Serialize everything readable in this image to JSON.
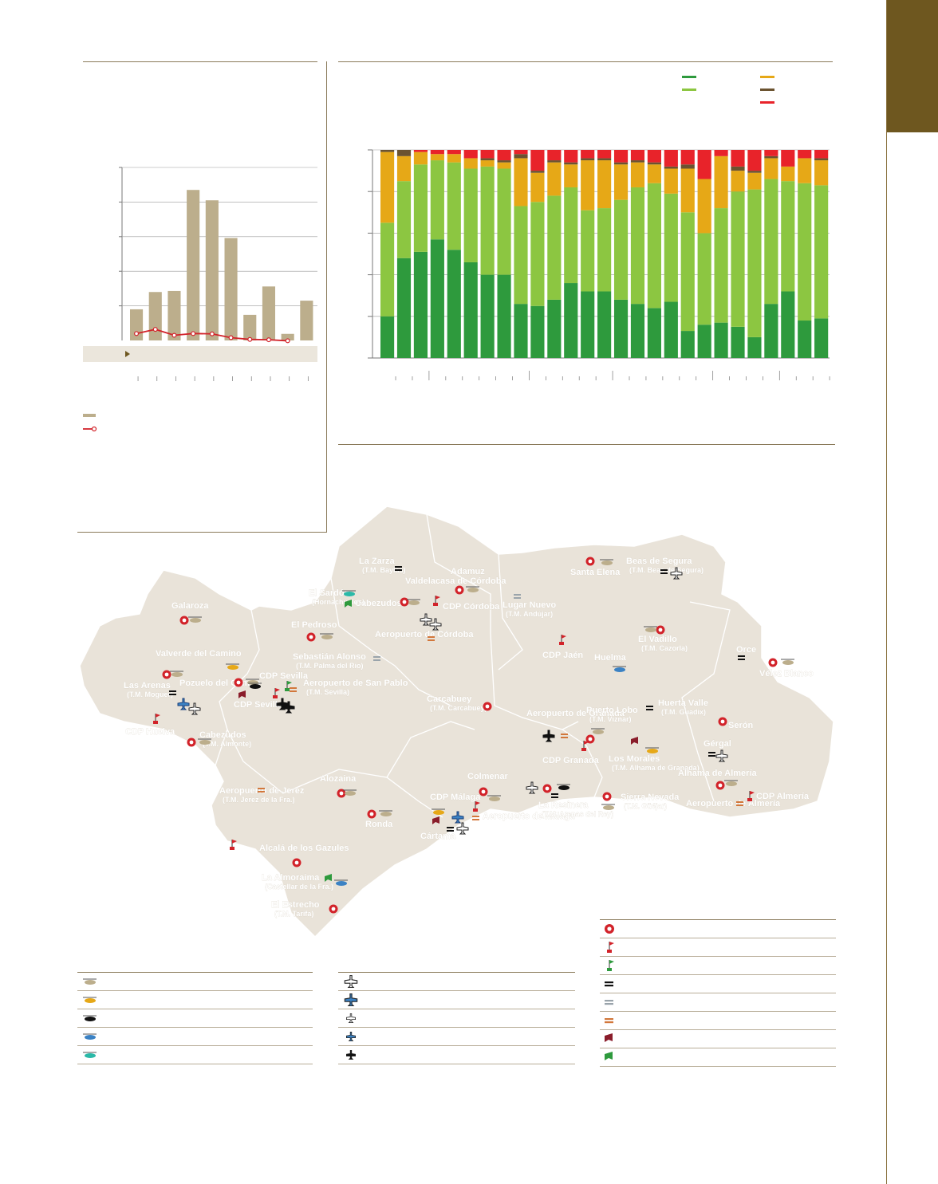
{
  "colors": {
    "brand": "#6e571f",
    "bar_tan": "#bcae8c",
    "line_red": "#d2232a",
    "dark_green": "#2e9a3d",
    "light_green": "#8cc641",
    "orange": "#e6a817",
    "brown": "#6b5330",
    "red": "#e8232a",
    "map_fill": "#e9e3d9",
    "map_stroke": "#ffffff",
    "label_white": "#ffffff"
  },
  "left_chart": {
    "chart_data": {
      "type": "bar",
      "values": [
        9,
        14,
        14.3,
        43.5,
        40.5,
        29.6,
        7.4,
        15.6,
        1.9,
        11.5
      ],
      "line_values": [
        2,
        3.2,
        1.5,
        2,
        1.9,
        0.8,
        0.3,
        0.2,
        -0.1
      ],
      "ylim": [
        0,
        50
      ],
      "grid": true,
      "title": "",
      "xlabel": "",
      "ylabel": ""
    },
    "legend_items": [
      {
        "name": "",
        "icon": "tan-bar-swatch"
      },
      {
        "name": "",
        "icon": "red-line-marker"
      }
    ],
    "strip_marker": "triangle-right-icon"
  },
  "right_chart": {
    "chart_data": {
      "type": "bar",
      "stacked": true,
      "ylim": [
        0,
        100
      ],
      "grid": true,
      "series": [
        {
          "color_key": "dark_green",
          "values": [
            20,
            48,
            51,
            57,
            52,
            46,
            40,
            40,
            26,
            25,
            28,
            36,
            32,
            32,
            28,
            26,
            24,
            27,
            13,
            16,
            17,
            15,
            10,
            26,
            32,
            18,
            19
          ]
        },
        {
          "color_key": "light_green",
          "values": [
            45,
            37,
            42,
            38,
            42,
            45,
            52,
            51,
            47,
            50,
            50,
            46,
            39,
            40,
            48,
            56,
            60,
            52,
            57,
            44,
            55,
            65,
            71,
            60,
            53,
            66,
            64
          ]
        },
        {
          "color_key": "orange",
          "values": [
            34,
            12,
            6,
            3,
            4,
            5,
            3,
            3,
            23,
            14,
            16,
            11,
            24,
            23,
            17,
            12,
            9,
            12,
            21,
            26,
            25,
            10,
            8,
            10,
            7,
            12,
            12
          ]
        },
        {
          "color_key": "brown",
          "values": [
            1,
            3,
            0,
            0,
            0,
            0,
            1,
            1,
            2,
            1,
            1,
            1,
            1,
            1,
            1,
            1,
            1,
            1,
            2,
            0,
            0,
            2,
            1,
            1,
            0,
            0,
            1
          ]
        },
        {
          "color_key": "red",
          "values": [
            0,
            0,
            1,
            2,
            2,
            4,
            4,
            5,
            2,
            10,
            5,
            6,
            4,
            4,
            6,
            5,
            6,
            8,
            7,
            14,
            3,
            8,
            10,
            3,
            8,
            4,
            4
          ]
        }
      ],
      "title": "",
      "xlabel": "",
      "ylabel": ""
    },
    "legend_items": [
      {
        "color_key": "dark_green",
        "name": ""
      },
      {
        "color_key": "light_green",
        "name": ""
      },
      {
        "color_key": "orange",
        "name": ""
      },
      {
        "color_key": "brown",
        "name": ""
      },
      {
        "color_key": "red",
        "name": ""
      }
    ]
  },
  "map": {
    "places": [
      {
        "name": "La Zarza",
        "sub": "(T.M. Baylas)"
      },
      {
        "name": "Valdelacasa de Córdoba"
      },
      {
        "name": "Adamuz"
      },
      {
        "name": "Santa Elena"
      },
      {
        "name": "Beas de Segura",
        "sub": "(T.M. Beas de Segura)"
      },
      {
        "name": "Cabezudos"
      },
      {
        "name": "Galaroza"
      },
      {
        "name": "El Pedroso"
      },
      {
        "name": "Aeropuerto de Córdoba"
      },
      {
        "name": "CDP Córdoba"
      },
      {
        "name": "Lugar Nuevo",
        "sub": "(T.M. Andújar)"
      },
      {
        "name": "El Vadillo",
        "sub": "(T.M. Cazorla)"
      },
      {
        "name": "Orce"
      },
      {
        "name": "Vélez Blanco"
      },
      {
        "name": "Valverde del Camino"
      },
      {
        "name": "Sebastián Alonso",
        "sub": "(T.M. Palma del Río)"
      },
      {
        "name": "CDP Jaén"
      },
      {
        "name": "Huelma"
      },
      {
        "name": "Las Arenas",
        "sub": "(T.M. Moguer)"
      },
      {
        "name": "Pozuelo del Campo"
      },
      {
        "name": "CDP Sevilla"
      },
      {
        "name": "Aeropuerto de San Pablo",
        "sub": "(T.M. Sevilla)"
      },
      {
        "name": "CDP Sevilla"
      },
      {
        "name": "Carcabuey",
        "sub": "(T.M. Carcabuey)"
      },
      {
        "name": "Aeropuerto de Granada"
      },
      {
        "name": "Puerto Lobo",
        "sub": "(T.M. Víznar)"
      },
      {
        "name": "Huerta Valle",
        "sub": "(T.M. Guadix)"
      },
      {
        "name": "Serón"
      },
      {
        "name": "CDP Huelva"
      },
      {
        "name": "Cabezudos",
        "sub": "(T.M. Almonte)"
      },
      {
        "name": "CDP Granada"
      },
      {
        "name": "Los Morales",
        "sub": "(T.M. Alhama de Granada)"
      },
      {
        "name": "Gérgal"
      },
      {
        "name": "Alhama de Almería"
      },
      {
        "name": "Aeropuerto de Jerez",
        "sub": "(T.M. Jerez de la Fra.)"
      },
      {
        "name": "Alozaina"
      },
      {
        "name": "Colmenar"
      },
      {
        "name": "CDP Málaga"
      },
      {
        "name": "Sierra Nevada",
        "sub": "(T.M. Güéjar)"
      },
      {
        "name": "Aeropuerto de Almería"
      },
      {
        "name": "CDP Almería"
      },
      {
        "name": "Ronda"
      },
      {
        "name": "Cártama"
      },
      {
        "name": "Aeropuerto de Málaga"
      },
      {
        "name": "La Resinera",
        "sub": "(T.M. Arenas del Rey)"
      },
      {
        "name": "Alcalá de los Gazules"
      },
      {
        "name": "La Almoraima",
        "sub": "(Castellar de la Fra.)"
      },
      {
        "name": "El Estrecho",
        "sub": "(T.M. Tarifa)"
      },
      {
        "name": "El Sardón",
        "sub": "(Hornachuelos)"
      }
    ]
  },
  "map_legend_left": [
    {
      "icon": "helicopter-tan-icon",
      "label": ""
    },
    {
      "icon": "helicopter-yellow-icon",
      "label": ""
    },
    {
      "icon": "helicopter-black-icon",
      "label": ""
    },
    {
      "icon": "helicopter-blue-icon",
      "label": ""
    },
    {
      "icon": "helicopter-teal-icon",
      "label": ""
    }
  ],
  "map_legend_mid": [
    {
      "icon": "plane-large-white-icon",
      "label": ""
    },
    {
      "icon": "plane-large-blue-icon",
      "label": ""
    },
    {
      "icon": "plane-small-white-icon",
      "label": ""
    },
    {
      "icon": "plane-small-blue-icon",
      "label": ""
    },
    {
      "icon": "plane-black-icon",
      "label": ""
    }
  ],
  "map_legend_right": [
    {
      "icon": "cdf-circle-icon",
      "label": ""
    },
    {
      "icon": "flag-red-icon",
      "label": ""
    },
    {
      "icon": "flag-green-icon",
      "label": ""
    },
    {
      "icon": "equal-black-icon",
      "label": ""
    },
    {
      "icon": "equal-grey-icon",
      "label": ""
    },
    {
      "icon": "equal-orange-icon",
      "label": ""
    },
    {
      "icon": "pennant-red-icon",
      "label": ""
    },
    {
      "icon": "pennant-green-icon",
      "label": ""
    }
  ]
}
